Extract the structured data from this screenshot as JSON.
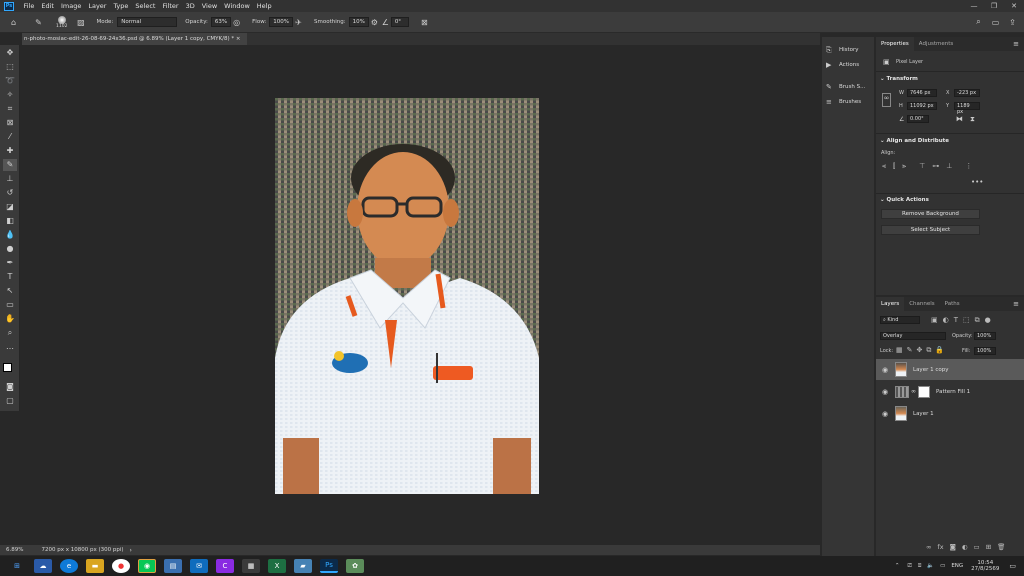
{
  "app": {
    "logo": "Ps"
  },
  "menu": [
    "File",
    "Edit",
    "Image",
    "Layer",
    "Type",
    "Select",
    "Filter",
    "3D",
    "View",
    "Window",
    "Help"
  ],
  "window_controls": [
    "—",
    "❐",
    "✕"
  ],
  "options": {
    "brush_size": "1102",
    "mode_label": "Mode:",
    "mode": "Normal",
    "opacity_label": "Opacity:",
    "opacity": "63%",
    "flow_label": "Flow:",
    "flow": "100%",
    "smoothing_label": "Smoothing:",
    "smoothing": "10%",
    "angle": "0°"
  },
  "document": {
    "tab": "n-photo-mosiac-edit-26-08-69-24x36.psd @ 6.89% (Layer 1 copy, CMYK/8) *",
    "tab_close": "×"
  },
  "status": {
    "zoom": "6.89%",
    "size": "7200 px x 10800 px (300 ppi)"
  },
  "dock": [
    "History",
    "Actions",
    "Brush S...",
    "Brushes"
  ],
  "properties": {
    "tabs": [
      "Properties",
      "Adjustments"
    ],
    "kind": "Pixel Layer",
    "transform_title": "Transform",
    "w_label": "W",
    "w": "7646 px",
    "x_label": "X",
    "x": "-223 px",
    "h_label": "H",
    "h": "11092 px",
    "y_label": "Y",
    "y": "1189 px",
    "angle": "0.00°",
    "align_title": "Align and Distribute",
    "align_label": "Align:",
    "quick_title": "Quick Actions",
    "remove_bg": "Remove Background",
    "select_subject": "Select Subject"
  },
  "layers_panel": {
    "tabs": [
      "Layers",
      "Channels",
      "Paths"
    ],
    "filter": "Kind",
    "blend": "Overlay",
    "opacity_label": "Opacity:",
    "opacity": "100%",
    "lock_label": "Lock:",
    "fill_label": "Fill:",
    "fill": "100%",
    "layers": [
      "Layer 1 copy",
      "Pattern Fill 1",
      "Layer 1"
    ]
  },
  "taskbar": {
    "lang": "ENG",
    "time": "10:54",
    "date": "27/8/2569"
  },
  "colors": {
    "accent": "#31a8ff",
    "bg": "#282828",
    "panel": "#323232"
  }
}
